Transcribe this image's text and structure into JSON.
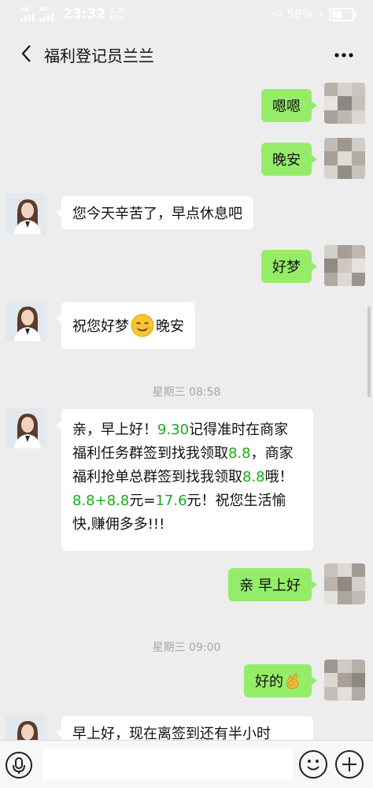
{
  "status_bar": {
    "net1": "4G",
    "net2": "4G",
    "time": "23:32",
    "speed_value": "0.30",
    "speed_unit": "KB/s",
    "net_right": "4G",
    "battery": "58%",
    "battery_level": 0.58
  },
  "header": {
    "back_icon": "chevron-left-icon",
    "title": "福利登记员兰兰",
    "more_icon": "more-dots-icon"
  },
  "messages": [
    {
      "side": "me",
      "text": "嗯嗯"
    },
    {
      "side": "me",
      "text": "晚安"
    },
    {
      "side": "agent",
      "text": "您今天辛苦了，早点休息吧"
    },
    {
      "side": "me",
      "text": "好梦"
    },
    {
      "side": "agent",
      "text_before": "祝您好梦",
      "emoji": "smile-emoji-icon",
      "text_after": "晚安"
    },
    {
      "type": "timestamp",
      "text": "星期三 08:58"
    },
    {
      "side": "agent",
      "long": {
        "p1": "亲，早上好！",
        "link1": "9.30",
        "p2": "记得准时在商家福利任务群签到找我领取",
        "link2": "8.8",
        "p3": "，商家福利抢单总群签到找我领取",
        "link3": "8.8",
        "p4": "哦！",
        "link4": "8.8+8.8",
        "p5": "元=",
        "link5": "17.6",
        "p6": "元！祝您生活愉快,赚佣多多!!!"
      }
    },
    {
      "side": "me",
      "text": "亲 早上好"
    },
    {
      "type": "timestamp",
      "text": "星期三 09:00"
    },
    {
      "side": "me",
      "text": "好的",
      "emoji": "ok-hand-emoji-icon"
    },
    {
      "side": "agent",
      "text": "早上好，现在离签到还有半小时"
    }
  ],
  "input_bar": {
    "voice_icon": "voice-icon",
    "emoji_icon": "emoji-icon",
    "plus_icon": "plus-icon"
  },
  "colors": {
    "background": "#ededed",
    "green_bubble": "#95ec69",
    "white_bubble": "#ffffff",
    "link": "#1aad19"
  }
}
